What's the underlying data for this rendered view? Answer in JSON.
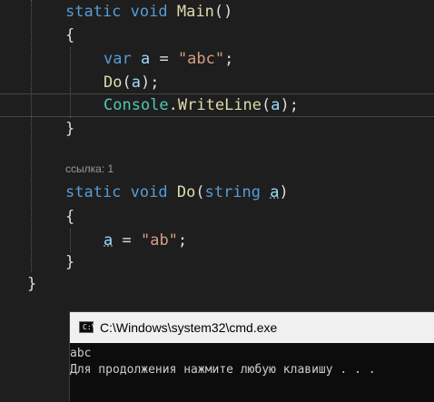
{
  "editor": {
    "main_sig": {
      "kw1": "static",
      "kw2": "void",
      "name": "Main",
      "rest": "()"
    },
    "open1": "{",
    "line_var": {
      "kw": "var",
      "varname": "a",
      "eq": " = ",
      "str": "\"abc\"",
      "end": ";"
    },
    "line_do": {
      "fn": "Do",
      "open": "(",
      "arg": "a",
      "close": ");"
    },
    "line_console": {
      "cls": "Console",
      "dot": ".",
      "fn": "WriteLine",
      "open": "(",
      "arg": "a",
      "close": ");"
    },
    "close1": "}",
    "codelens": "ссылка: 1",
    "do_sig": {
      "kw1": "static",
      "kw2": "void",
      "name": "Do",
      "open": "(",
      "type": "string",
      "param": "a",
      "close": ")"
    },
    "open2": "{",
    "line_assign": {
      "varname": "a",
      "eq": " = ",
      "str": "\"ab\"",
      "end": ";"
    },
    "close2": "}",
    "close_class": "}"
  },
  "console_window": {
    "title": "C:\\Windows\\system32\\cmd.exe",
    "icon_prompt": "C:\\",
    "output": [
      "abc",
      "Для продолжения нажмите любую клавишу . . ."
    ]
  },
  "colors": {
    "background": "#1e1e1e",
    "keyword": "#569cd6",
    "method": "#dcdcaa",
    "string": "#d69d85",
    "variable": "#9cdcfe",
    "class": "#4ec9b0"
  }
}
